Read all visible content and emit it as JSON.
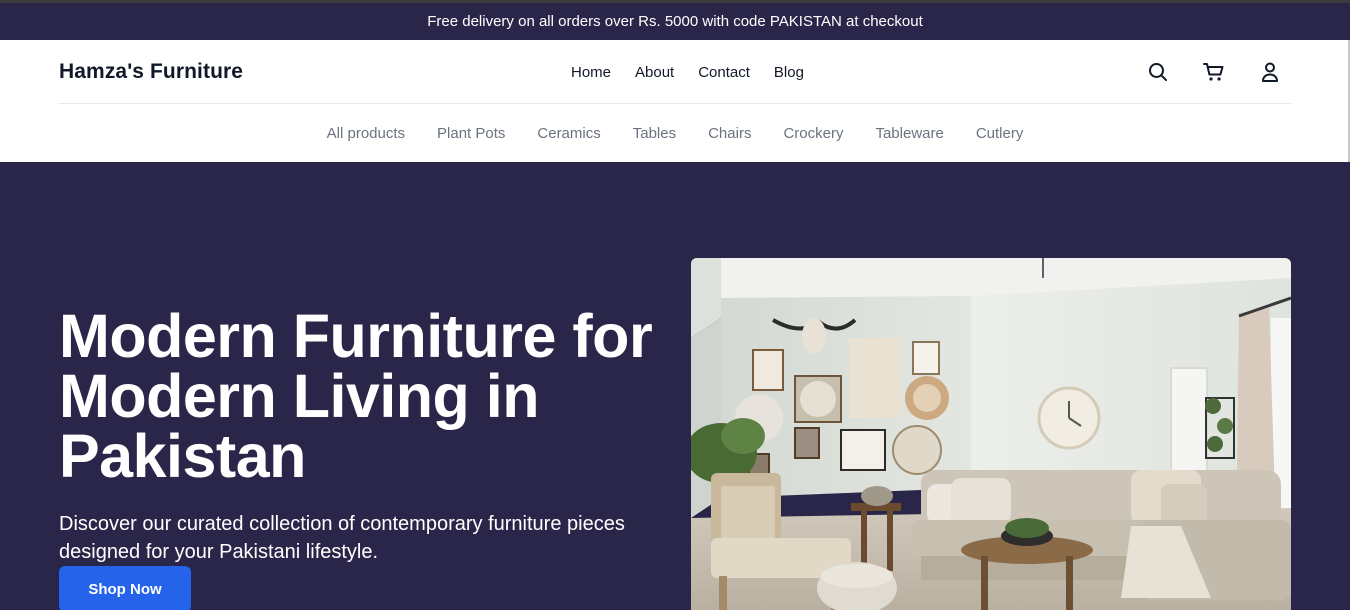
{
  "announcement": "Free delivery on all orders over Rs. 5000 with code PAKISTAN at checkout",
  "brand": "Hamza's Furniture",
  "main_nav": [
    "Home",
    "About",
    "Contact",
    "Blog"
  ],
  "header_icons": [
    "search-icon",
    "cart-icon",
    "user-icon"
  ],
  "categories": [
    "All products",
    "Plant Pots",
    "Ceramics",
    "Tables",
    "Chairs",
    "Crockery",
    "Tableware",
    "Cutlery"
  ],
  "hero": {
    "title": "Modern Furniture for Modern Living in Pakistan",
    "subtitle": "Discover our curated collection of contemporary furniture pieces designed for your Pakistani lifestyle.",
    "cta": "Shop Now"
  },
  "colors": {
    "primary_bg": "#2a2649",
    "cta": "#2563eb",
    "nav_text": "#111827",
    "category_text": "#6b7280"
  }
}
